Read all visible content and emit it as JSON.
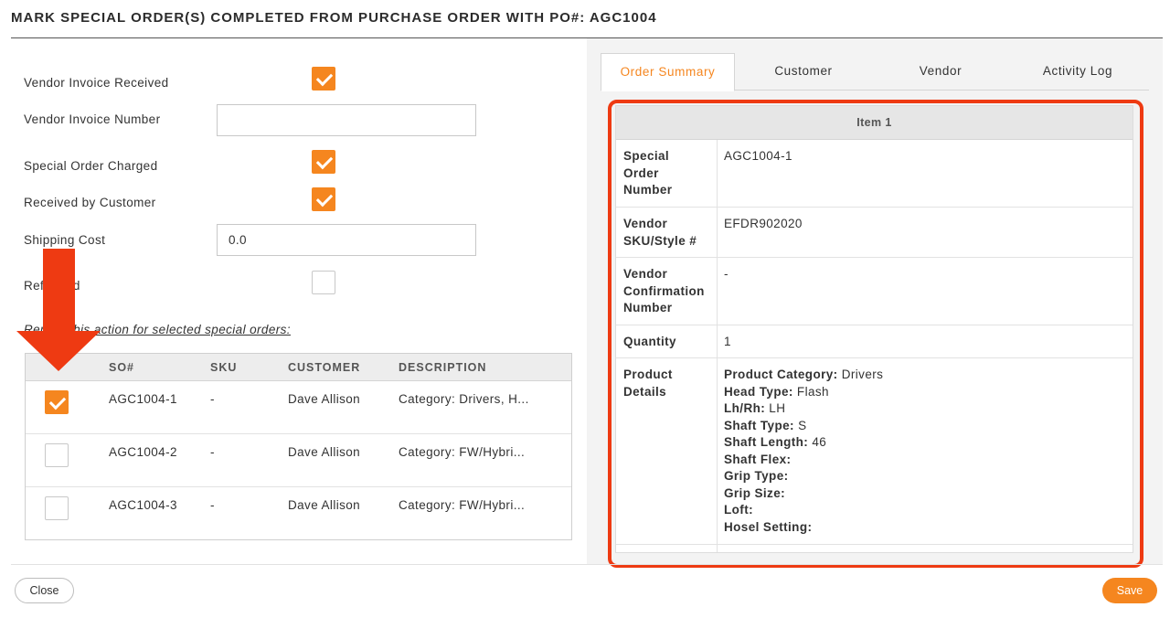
{
  "header": {
    "title": "MARK SPECIAL ORDER(S) COMPLETED FROM PURCHASE ORDER WITH PO#: AGC1004"
  },
  "form": {
    "vendor_invoice_received": {
      "label": "Vendor Invoice Received",
      "checked": true
    },
    "vendor_invoice_number": {
      "label": "Vendor Invoice Number",
      "value": ""
    },
    "special_order_charged": {
      "label": "Special Order Charged",
      "checked": true
    },
    "received_by_customer": {
      "label": "Received by Customer",
      "checked": true
    },
    "shipping_cost": {
      "label": "Shipping Cost",
      "value": "0.0"
    },
    "refunded": {
      "label": "Refunded",
      "checked": false
    },
    "repeat_label": "Repeat this action for selected special orders:"
  },
  "so_table": {
    "columns": [
      "SO#",
      "SKU",
      "CUSTOMER",
      "DESCRIPTION"
    ],
    "rows": [
      {
        "checked": true,
        "so": "AGC1004-1",
        "sku": "-",
        "customer": "Dave Allison",
        "description": "Category: Drivers, H..."
      },
      {
        "checked": false,
        "so": "AGC1004-2",
        "sku": "-",
        "customer": "Dave Allison",
        "description": "Category: FW/Hybri..."
      },
      {
        "checked": false,
        "so": "AGC1004-3",
        "sku": "-",
        "customer": "Dave Allison",
        "description": "Category: FW/Hybri..."
      }
    ]
  },
  "tabs": [
    {
      "label": "Order Summary",
      "active": true
    },
    {
      "label": "Customer",
      "active": false
    },
    {
      "label": "Vendor",
      "active": false
    },
    {
      "label": "Activity Log",
      "active": false
    }
  ],
  "summary": {
    "item_header": "Item 1",
    "special_order_number": {
      "key": "Special Order Number",
      "value": "AGC1004-1"
    },
    "vendor_sku": {
      "key": "Vendor SKU/Style #",
      "value": "EFDR902020"
    },
    "vendor_confirmation": {
      "key": "Vendor Confirmation Number",
      "value": "-"
    },
    "quantity": {
      "key": "Quantity",
      "value": "1"
    },
    "product_details": {
      "key": "Product Details",
      "lines": [
        {
          "k": "Product Category:",
          "v": "Drivers"
        },
        {
          "k": "Head Type:",
          "v": "Flash"
        },
        {
          "k": "Lh/Rh:",
          "v": "LH"
        },
        {
          "k": "Shaft Type:",
          "v": "S"
        },
        {
          "k": "Shaft Length:",
          "v": "46"
        },
        {
          "k": "Shaft Flex:",
          "v": ""
        },
        {
          "k": "Grip Type:",
          "v": ""
        },
        {
          "k": "Grip Size:",
          "v": ""
        },
        {
          "k": "Loft:",
          "v": ""
        },
        {
          "k": "Hosel Setting:",
          "v": ""
        }
      ]
    }
  },
  "footer": {
    "close_label": "Close",
    "save_label": "Save"
  },
  "colors": {
    "accent": "#f5861f",
    "annotation": "#ee3a12"
  }
}
